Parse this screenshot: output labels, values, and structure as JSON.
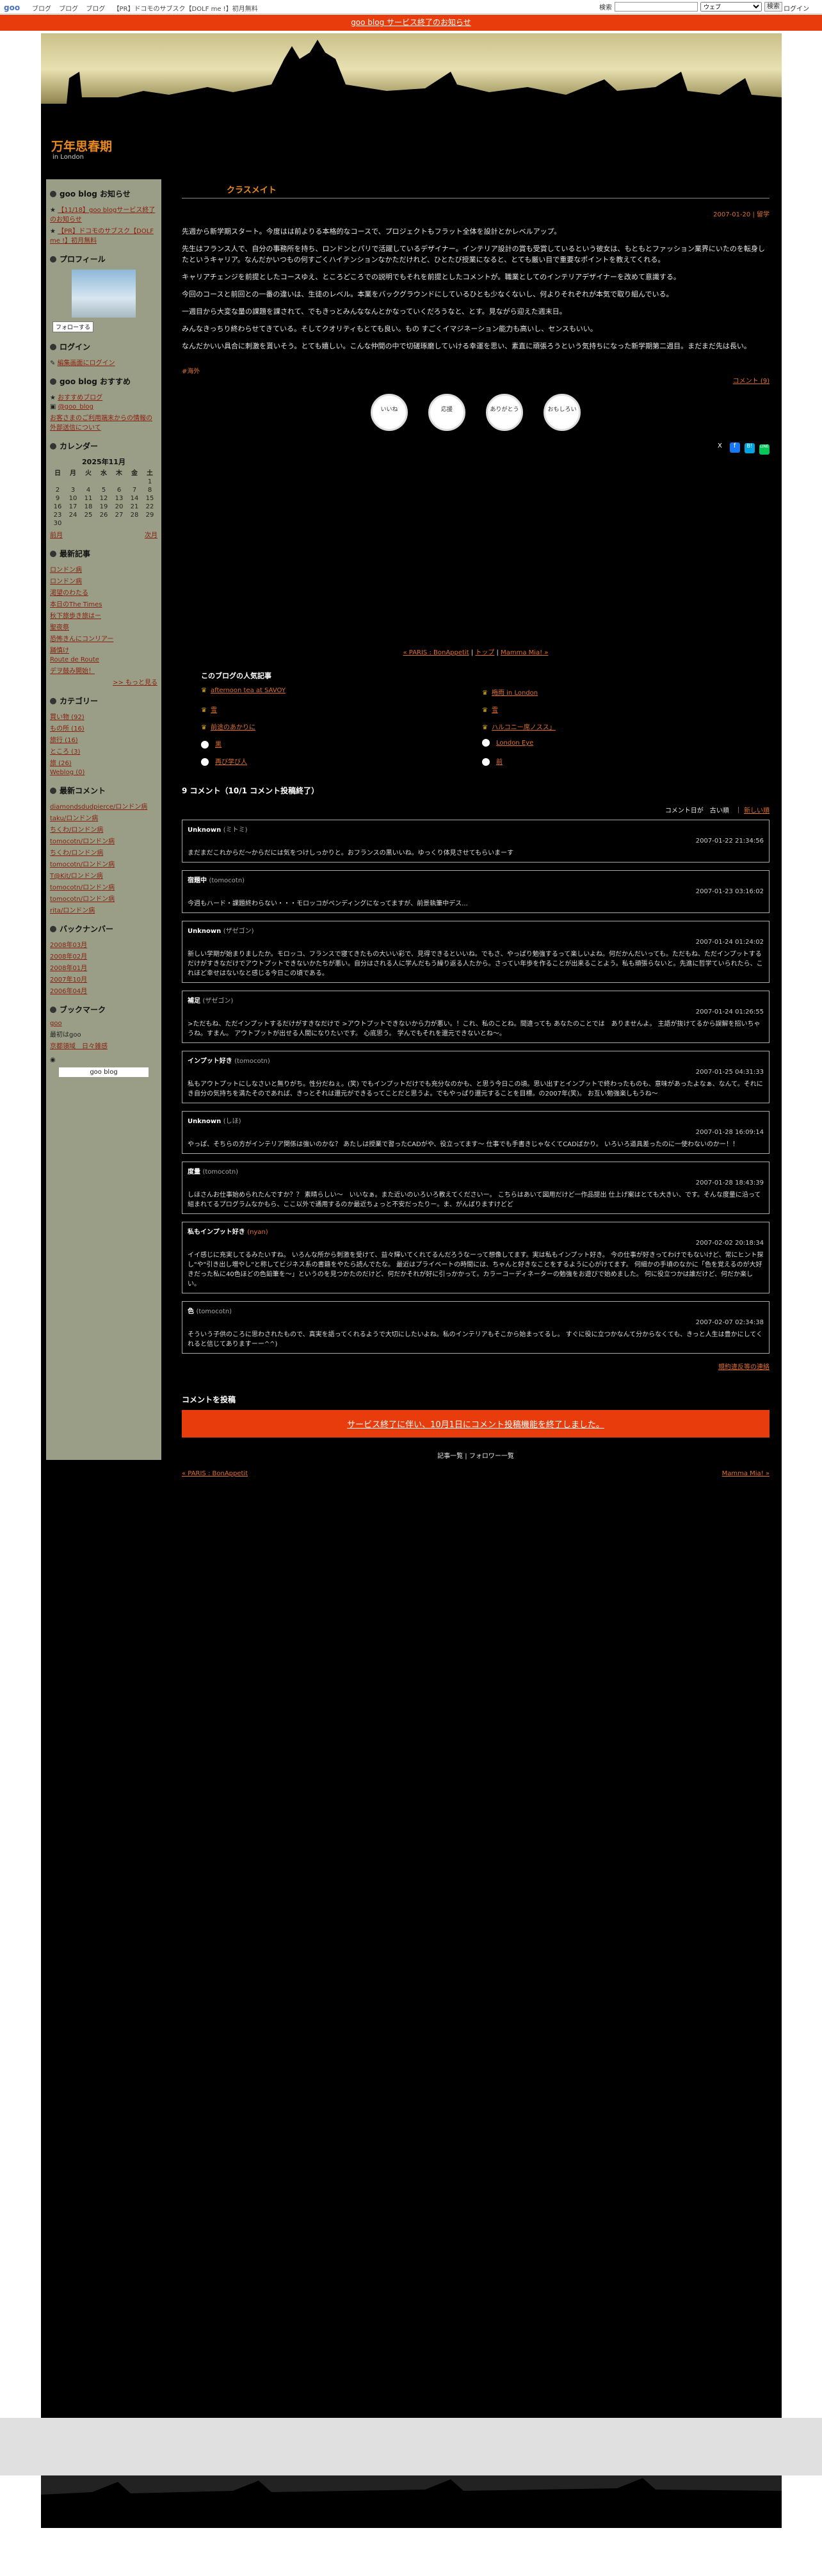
{
  "gbar": {
    "logo": "goo",
    "links": [
      "ブログ",
      "ブログ",
      "ブログ",
      "【PR】ドコモのサブスク【DOLF me !】初月無料"
    ],
    "search_label": "検索",
    "search_scope": "ウェブ",
    "search_btn": "検索",
    "login": "ログイン"
  },
  "notice": "goo blog サービス終了のお知らせ",
  "blog": {
    "title": "万年思春期",
    "subtitle": "in London"
  },
  "sidebar": {
    "sec_info": "goo blog お知らせ",
    "info_items": [
      "【11/18】goo blogサービス終了のお知らせ",
      "【PR】ドコモのサブスク【DOLF me !】初月無料"
    ],
    "sec_profile": "プロフィール",
    "follow": "フォローする",
    "sec_login": "ログイン",
    "login_link": "編集画面にログイン",
    "sec_recommend": "goo blog おすすめ",
    "recommend_link": "おすすめブログ",
    "twitter": "@goo_blog",
    "notice_link": "お客さまのご利用端末からの情報の外部送信について",
    "sec_calendar": "カレンダー",
    "cal_title": "2025年11月",
    "cal_head": [
      "日",
      "月",
      "火",
      "水",
      "木",
      "金",
      "土"
    ],
    "cal_prev": "前月",
    "cal_next": "次月",
    "sec_recent": "最新記事",
    "recent": [
      "ロンドン病",
      "ロンドン病",
      "渇望のわたる",
      "本日のThe Times",
      "秋下旅歩き旅はー",
      "聖夜祭",
      "恐怖きんにコンリアー",
      "踊慎け",
      "Route de Route",
      "デヲ鼓み開始！"
    ],
    "more": ">> もっと見る",
    "sec_category": "カテゴリー",
    "categories": [
      "買い物 (92)",
      "もの所 (16)",
      "旅行 (16)",
      "ところ (3)",
      "旅 (26)",
      "Weblog (0)"
    ],
    "sec_comments": "最新コメント",
    "comments": [
      "diamondsdudpierce/ロンドン病",
      "taku/ロンドン病",
      "ちくわ/ロンドン病",
      "tomocotn/ロンドン病",
      "ちくわ/ロンドン病",
      "tomocotn/ロンドン病",
      "T@Kit/ロンドン病",
      "tomocotn/ロンドン病",
      "tomocotn/ロンドン病",
      "rita/ロンドン病"
    ],
    "sec_backnumber": "バックナンバー",
    "backnumbers": [
      "2008年03月",
      "2008年02月",
      "2008年01月",
      "2007年10月",
      "2006年04月"
    ],
    "sec_bookmark": "ブックマーク",
    "bookmarks": [
      "goo",
      "最初はgoo",
      "京都領域　日々雑感"
    ],
    "goo_blog": "goo blog"
  },
  "post": {
    "title": "クラスメイト",
    "date": "2007-01-20 | 留学",
    "paragraphs": [
      "先週から新学期スタート。今度はは前よりる本格的なコースで、プロジェクトもフラット全体を設計とかレベルアップ。",
      "先生はフランス人で、自分の事務所を持ち、ロンドンとパリで活躍しているデザイナー。インテリア設計の賞も受賞しているという彼女は、もともとファッション業界にいたのを転身したというキャリア。なんだかいつもの何すごくハイテンションなかただけれど、ひとたび授業になると、とても厳い目で重要なポイントを教えてくれる。",
      "キャリアチェンジを前提としたコースゆえ、ところどころでの説明でもそれを前提としたコメントが。職業としてのインテリアデザイナーを改めて意識する。",
      "今回のコースと前回との一番の違いは、生徒のレベル。本業をバックグラウンドにしているひとも少なくないし、何よりそれぞれが本気で取り組んでいる。",
      "一週目から大変な量の課題を課されて、でもきっとみんななんとかなっていくだろうなと、とす。見ながら迎えた週末日。",
      "みんなきっちり終わらせてきている。そしてクオリティもとても良い。もの すごくイマジネーション能力も高いし、センスもいい。",
      "なんだかいい具合に刺激を貰いそう。とても嬉しい。こんな仲間の中で切磋琢磨していける幸運を思い、素直に頑張ろうという気持ちになった新学期第二週目。まだまだ先は長い。"
    ],
    "tag": "#海外",
    "comment_link": "コメント (9)",
    "reactions": [
      "いいね",
      "応援",
      "ありがとう",
      "おもしろい"
    ],
    "share": [
      "X",
      "f",
      "B!",
      "LINE"
    ],
    "pager_prev": "« PARIS : BonAppetit",
    "pager_top": "トップ",
    "pager_next": "Mamma Mia! »"
  },
  "popular": {
    "title": "このブログの人気記事",
    "items": [
      "afternoon tea at SAVOY",
      "梅雨 in London",
      "雪",
      "雪",
      "前途のあかりに",
      "ハルコニー席ノスス」",
      "黒",
      "London Eye",
      "再び学び人",
      "前"
    ]
  },
  "comments": {
    "count_title": "9 コメント（10/1 コメント投稿終了）",
    "sort": "コメント日が　古い順　｜",
    "sort_new": "新しい順",
    "items": [
      {
        "who": "Unknown",
        "sub": "(ミトミ)",
        "date": "2007-01-22 21:34:56",
        "text": "まだまだこれからだ～からだには気をつけしっかりと。おフランスの黒いいね。ゆっくり体見させてもらいまーす"
      },
      {
        "who": "宿題中",
        "sub": "(tomocotn)",
        "date": "2007-01-23 03:16:02",
        "text": "今週もハード・課題終わらない・・・モロッコがペンディングになってますが、前景執筆中デス..."
      },
      {
        "who": "Unknown",
        "sub": "(ザゼゴン)",
        "date": "2007-01-24 01:24:02",
        "text": "新しい学期が始まりましたか。モロッコ、フランスで寝てきたもの大いい彩で、見得できるといいね。でもさ、やっぱり勉強するって楽しいよね。何だかんだいっても。ただもね、ただインプットするだけがすきなだけでアウトプットできないかたちが悪い。自分はされる人に学んだもう繰り返る人たから。さってい年歩を作ることが出来ることよう。私も頑張らないと。先進に哲学ていられたら、これほど幸せはないなと感じる今日この頃である。"
      },
      {
        "who": "補足",
        "sub": "(ザゼゴン)",
        "date": "2007-01-24 01:26:55",
        "text": ">ただもね、ただインプットするだけがすきなだけで >アウトプットできないから力が悪い。！これ、私のことね。間違っても あなたのことでは　ありませんよ。 主語が抜けてるから誤解を招いちゃうね。すまん。 アウトプットが出せる人間になりたいです。 心底思う。 学んでもそれを還元できないとね～。"
      },
      {
        "who": "インプット好き",
        "sub": "(tomocotn)",
        "date": "2007-01-25 04:31:33",
        "text": "私もアウトプットにしなさいと無りがち。性分だねぇ。(笑) でもインプットだけでも充分なのかも、と思う今日この頃。思い出すとインプットで終わったものも、意味があったよなぁ、なんて。それにき自分の気持ちを満たそのであれば、きっとそれは還元ができるってことだと思うよ。でもやっぱり還元することを目標。の2007年(笑)。 お互い勉強楽しもうね～"
      },
      {
        "who": "Unknown",
        "sub": "(しほ)",
        "date": "2007-01-28 16:09:14",
        "text": "やっぱ、そちらの方がインテリア関係は強いのかな？ あたしは授業で習ったCADがや、役立ってます～ 仕事でも手書きじゃなくてCADばかり。 いろいろ道具差ったのに一使わないのかー！！"
      },
      {
        "who": "度量",
        "sub": "(tomocotn)",
        "date": "2007-01-28 18:43:39",
        "text": "しほさんお仕事始められたんですか？？ 素晴らしい～　いいなぁ。また近いのいろいろ教えてくださいー。 こちらはあいて図用だけど一作品提出 仕上げ案はとても大きい、です。そんな度量に沿って組まれてるプログラムなかもら、ここ以外で通用するのか最近ちょっと不安だったりー。ま、がんばりますけどど"
      },
      {
        "who": "私もインプット好き",
        "sub": "(nyan)",
        "date": "2007-02-02 20:18:34",
        "text": "イイ感じに充実してるみたいすね。 いろんな所から刺激を受けて、益々輝いてくれてるんだろうなーって想像してます。実は私もインプット好き。 今の仕事が好きってわけでもないけど、常にヒント探し\"や\"引き出し増やし\"と称してビジネス系の書籍をやたら読んでたな。 最近はプライベートの時間には、ちゃんと好きなことをするように心がけてます。 何細かの手頃のなかに「色を覚えるのが大好きだった私に40色ほどの色鉛筆を～」というのを見つかたのだけど、何だかそれが好に引っかかって。カラーコーディネーターの勉強をお遊びで始めました。 何に役立つかは誰だけど、何だか楽しい。"
      },
      {
        "who": "色",
        "sub": "(tomocotn)",
        "date": "2007-02-07 02:34:38",
        "text": "そういう子供のころに思わされたもので、真実を語ってくれるようで大切にしたいよね。私のインテリアもそこから始まってるし。 すぐに役に立つかなんて分からなくても、きっと人生は豊かにしてくれると信じてありますーー^^)"
      }
    ],
    "report_link": "規約違反等の連絡",
    "post_title": "コメントを投稿",
    "ended": "サービス終了に伴い、10月1日にコメント投稿機能を終了しました。",
    "footer_links": "記事一覧 | フォロワー一覧",
    "prev": "« PARIS : BonAppetit",
    "next": "Mamma Mia! »"
  }
}
